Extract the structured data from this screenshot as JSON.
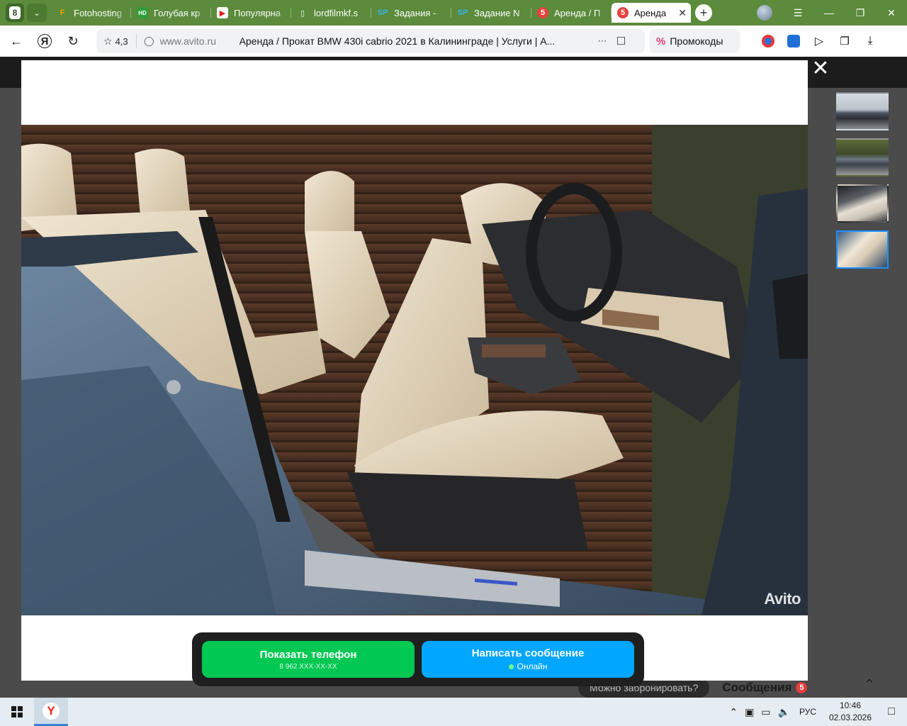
{
  "browser": {
    "tab_counter": "8",
    "tabs": [
      {
        "label": "Fotohosting",
        "icon": "F",
        "icon_color": "#f5a300",
        "icon_bg": "transparent"
      },
      {
        "label": "Голубая кр",
        "icon": "HD",
        "icon_color": "#ffffff",
        "icon_bg": "#2e9d3a"
      },
      {
        "label": "Популярна",
        "icon": "▶",
        "icon_color": "#d8241c",
        "icon_bg": "#ffffff"
      },
      {
        "label": "lordfilmkf.s",
        "icon": "▯",
        "icon_color": "#ffffff",
        "icon_bg": "transparent"
      },
      {
        "label": "Задания - ",
        "icon": "SP",
        "icon_color": "#3bb2e8",
        "icon_bg": "transparent"
      },
      {
        "label": "Задание N",
        "icon": "SP",
        "icon_color": "#3bb2e8",
        "icon_bg": "transparent"
      },
      {
        "label": "Аренда / П",
        "icon": "5",
        "icon_color": "#ffffff",
        "icon_bg": "#e8413c"
      },
      {
        "label": "Аренда",
        "icon": "5",
        "icon_color": "#ffffff",
        "icon_bg": "#e8413c",
        "active": true
      }
    ],
    "address": {
      "rating": "4,3",
      "domain": "www.avito.ru",
      "title": "Аренда / Прокат BMW 430i cabrio 2021 в Калининграде | Услуги | А..."
    },
    "promo_label": "Промокоды"
  },
  "gallery": {
    "watermark": "Avito",
    "thumbnails": [
      "thumb-1",
      "thumb-2",
      "thumb-3",
      "thumb-4"
    ],
    "selected_index": 3
  },
  "actions": {
    "phone_label": "Показать телефон",
    "phone_number": "8 962 XXX-XX-XX",
    "message_label": "Написать сообщение",
    "message_status": "Онлайн"
  },
  "page_under": {
    "booking_prompt": "Можно забронировать?",
    "messages_label": "Сообщения",
    "messages_count": "5"
  },
  "taskbar": {
    "language": "РУС",
    "time": "10:46",
    "date": "02.03.2026"
  },
  "colors": {
    "tabbar": "#5b8b3b",
    "phone_button": "#00c853",
    "message_button": "#00a6ff",
    "thumb_selected": "#1e90ff"
  }
}
